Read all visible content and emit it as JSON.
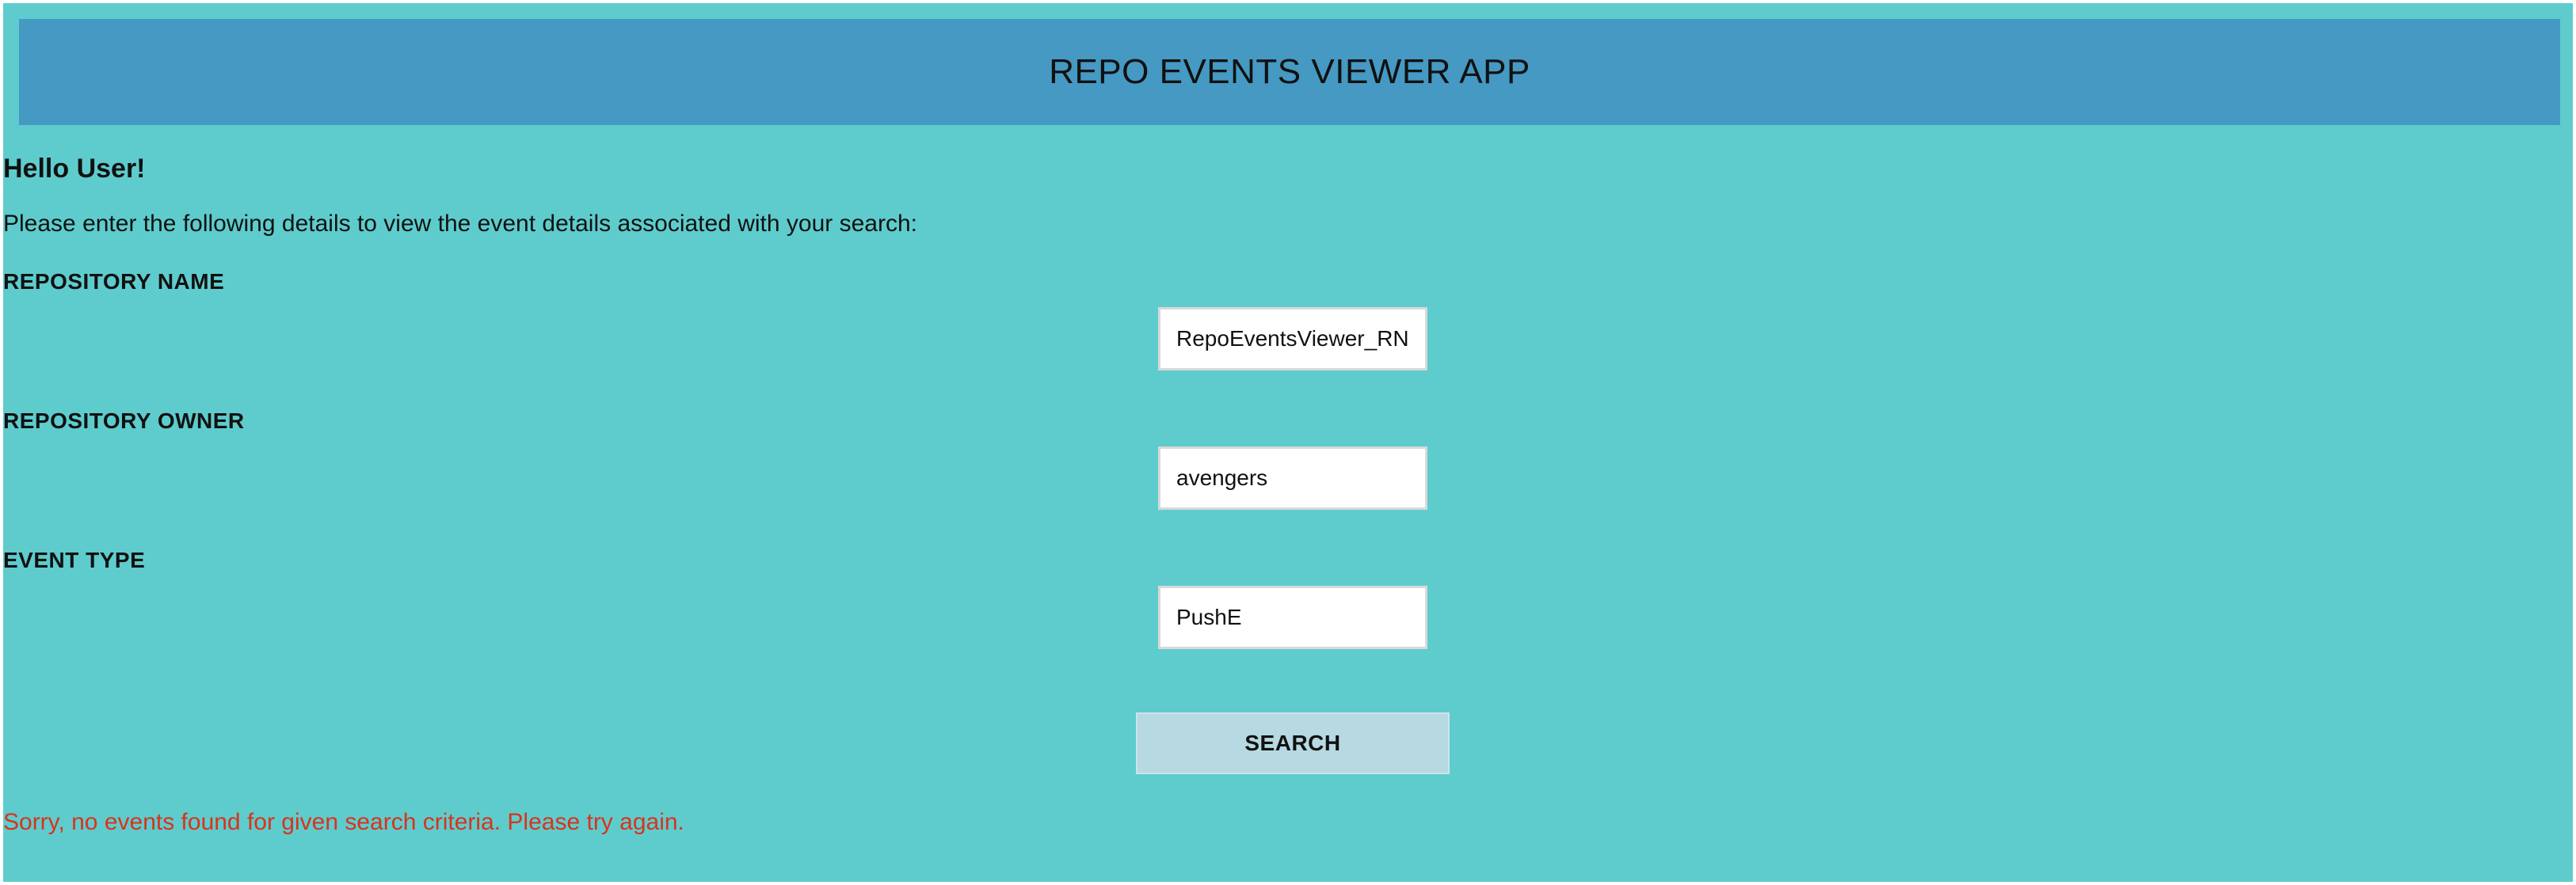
{
  "header": {
    "title": "REPO EVENTS VIEWER APP"
  },
  "main": {
    "greeting": "Hello User!",
    "instructions": "Please enter the following details to view the event details associated with your search:"
  },
  "form": {
    "repository_name": {
      "label": "REPOSITORY NAME",
      "value": "RepoEventsViewer_RN"
    },
    "repository_owner": {
      "label": "REPOSITORY OWNER",
      "value": "avengers"
    },
    "event_type": {
      "label": "EVENT TYPE",
      "value": "PushE"
    },
    "search_label": "SEARCH"
  },
  "error_message": "Sorry, no events found for given search criteria. Please try again.",
  "colors": {
    "background": "#5ecccd",
    "header": "#4599c3",
    "button": "#b6d9e2",
    "error": "#d9331c"
  }
}
